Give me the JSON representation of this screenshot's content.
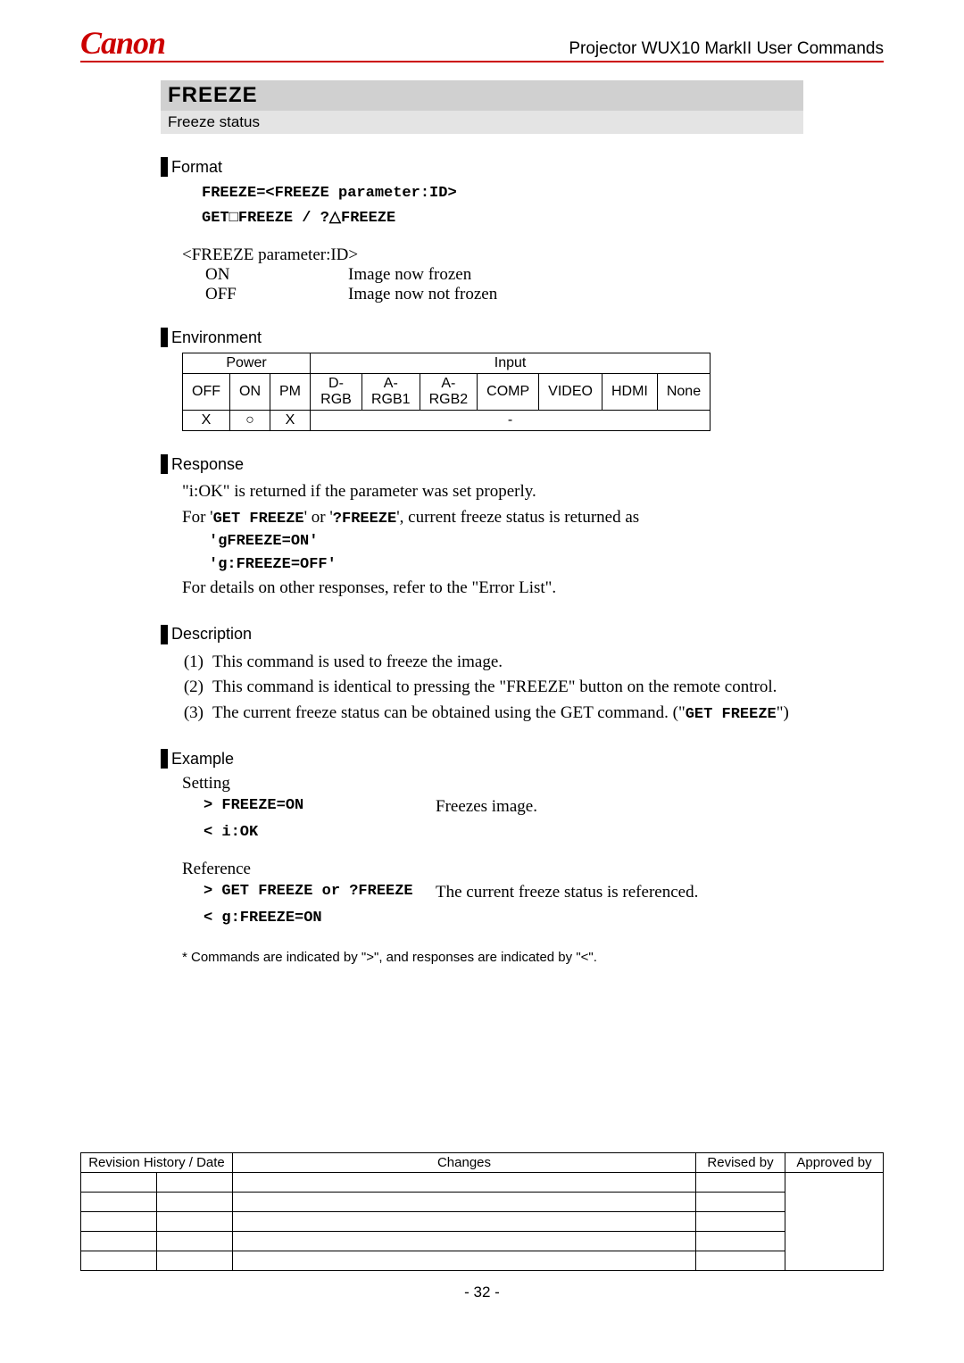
{
  "header": {
    "brand": "Canon",
    "doc_title": "Projector WUX10 MarkII User Commands"
  },
  "command": {
    "title": "FREEZE",
    "subtitle": "Freeze status"
  },
  "sections": {
    "format": {
      "heading": "Format",
      "line1_pre": "FREEZE=<FREEZE parameter:ID>",
      "line2_a": "GET",
      "line2_sq": "□",
      "line2_b": "FREEZE",
      "line2_sep": "   /   ?",
      "line2_tri": "△",
      "line2_c": "FREEZE",
      "param_head": "<FREEZE parameter:ID>",
      "params": [
        {
          "id": "ON",
          "desc": "Image now frozen"
        },
        {
          "id": "OFF",
          "desc": "Image now not frozen"
        }
      ]
    },
    "environment": {
      "heading": "Environment",
      "power_label": "Power",
      "input_label": "Input",
      "cols_power": [
        "OFF",
        "ON",
        "PM"
      ],
      "cols_input": [
        "D-RGB",
        "A-RGB1",
        "A-RGB2",
        "COMP",
        "VIDEO",
        "HDMI",
        "None"
      ],
      "row_power": [
        "X",
        "○",
        "X"
      ],
      "row_input_merged": "-"
    },
    "response": {
      "heading": "Response",
      "line1": "\"i:OK\" is returned if the parameter was set properly.",
      "line2_a": "For '",
      "line2_cmd1": "GET FREEZE",
      "line2_b": "' or '",
      "line2_cmd2": "?FREEZE",
      "line2_c": "', current freeze status is returned as",
      "code1": "'gFREEZE=ON'",
      "code2": "'g:FREEZE=OFF'",
      "line3": "For details on other responses, refer to the \"Error List\"."
    },
    "description": {
      "heading": "Description",
      "items": [
        "This command is used to freeze the image.",
        "This command is identical to pressing the \"FREEZE\" button on the remote control.",
        "The current freeze status can be obtained using the GET command. (\""
      ],
      "item3_cmd": "GET FREEZE",
      "item3_tail": "\")"
    },
    "example": {
      "heading": "Example",
      "setting_label": "Setting",
      "setting_cmd": "> FREEZE=ON",
      "setting_desc": "Freezes image.",
      "setting_resp": "< i:OK",
      "reference_label": "Reference",
      "ref_cmd": "> GET FREEZE or ?FREEZE",
      "ref_desc": "The current freeze status is referenced.",
      "ref_resp": "< g:FREEZE=ON",
      "note": "* Commands are indicated by \">\", and responses are indicated by \"<\"."
    }
  },
  "revision_table": {
    "h1": "Revision History / Date",
    "h2": "Changes",
    "h3": "Revised by",
    "h4": "Approved by"
  },
  "page_number": "- 32 -"
}
